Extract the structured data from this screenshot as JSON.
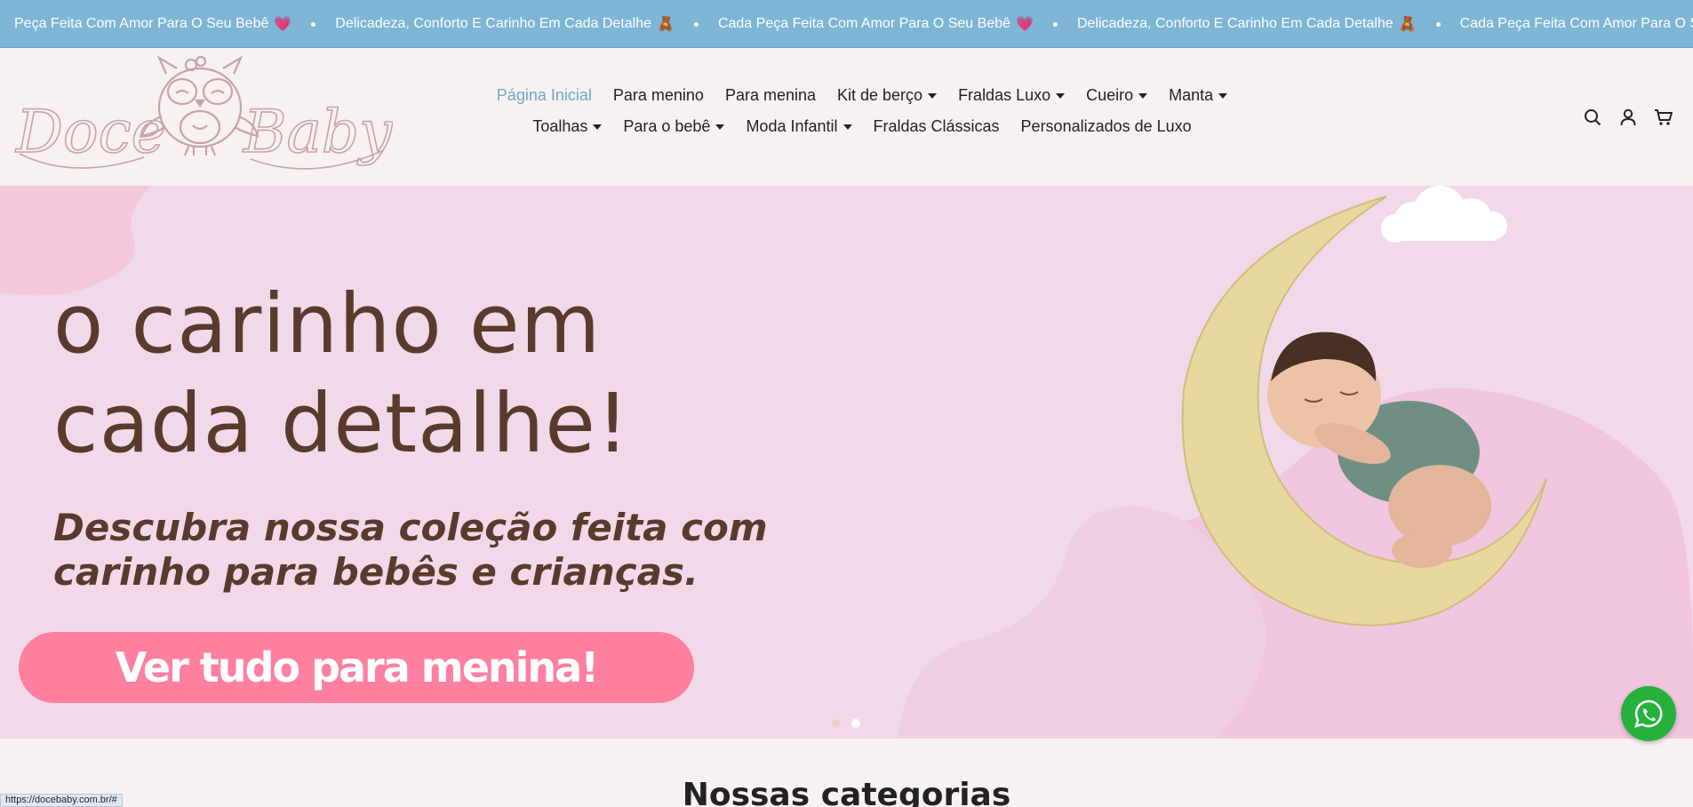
{
  "ticker": {
    "items": [
      {
        "text": "Peça Feita Com Amor Para O Seu Bebê",
        "emoji": "💗"
      },
      {
        "text": "Delicadeza, Conforto E Carinho Em Cada Detalhe",
        "emoji": "🧸"
      },
      {
        "text": "Cada Peça Feita Com Amor Para O Seu Bebê",
        "emoji": "💗"
      },
      {
        "text": "Delicadeza, Conforto E Carinho Em Cada Detalhe",
        "emoji": "🧸"
      },
      {
        "text": "Cada Peça Feita Com Amor Para O Seu Be",
        "emoji": ""
      }
    ]
  },
  "logo": {
    "text_left": "Doce",
    "text_right": "Baby"
  },
  "nav": {
    "row1": [
      {
        "label": "Página Inicial",
        "active": true,
        "dropdown": false
      },
      {
        "label": "Para menino",
        "active": false,
        "dropdown": false
      },
      {
        "label": "Para menina",
        "active": false,
        "dropdown": false
      },
      {
        "label": "Kit de berço",
        "active": false,
        "dropdown": true
      },
      {
        "label": "Fraldas Luxo",
        "active": false,
        "dropdown": true
      },
      {
        "label": "Cueiro",
        "active": false,
        "dropdown": true
      },
      {
        "label": "Manta",
        "active": false,
        "dropdown": true
      }
    ],
    "row2": [
      {
        "label": "Toalhas",
        "active": false,
        "dropdown": true
      },
      {
        "label": "Para o bebê",
        "active": false,
        "dropdown": true
      },
      {
        "label": "Moda Infantil",
        "active": false,
        "dropdown": true
      },
      {
        "label": "Fraldas Clássicas",
        "active": false,
        "dropdown": false
      },
      {
        "label": "Personalizados de Luxo",
        "active": false,
        "dropdown": false
      }
    ]
  },
  "header_icons": [
    "search-icon",
    "account-icon",
    "cart-icon"
  ],
  "hero": {
    "headline_line1": "o carinho em",
    "headline_line2": "cada detalhe!",
    "subtitle_line1": "Descubra nossa coleção feita com",
    "subtitle_line2": "carinho para bebês e crianças.",
    "cta_label": "Ver tudo para menina!",
    "slides": 2,
    "active_slide": 0
  },
  "categories": {
    "title": "Nossas categorias"
  },
  "status_bar": {
    "url": "https://docebaby.com.br/#"
  },
  "colors": {
    "ticker_bg": "#7fb6d6",
    "active_nav": "#6fa9c9",
    "hero_bg": "#f1d9e9",
    "headline": "#5a3a2c",
    "cta": "#ff7f9f",
    "whatsapp": "#25b13c",
    "logo": "#c9a3a3"
  }
}
